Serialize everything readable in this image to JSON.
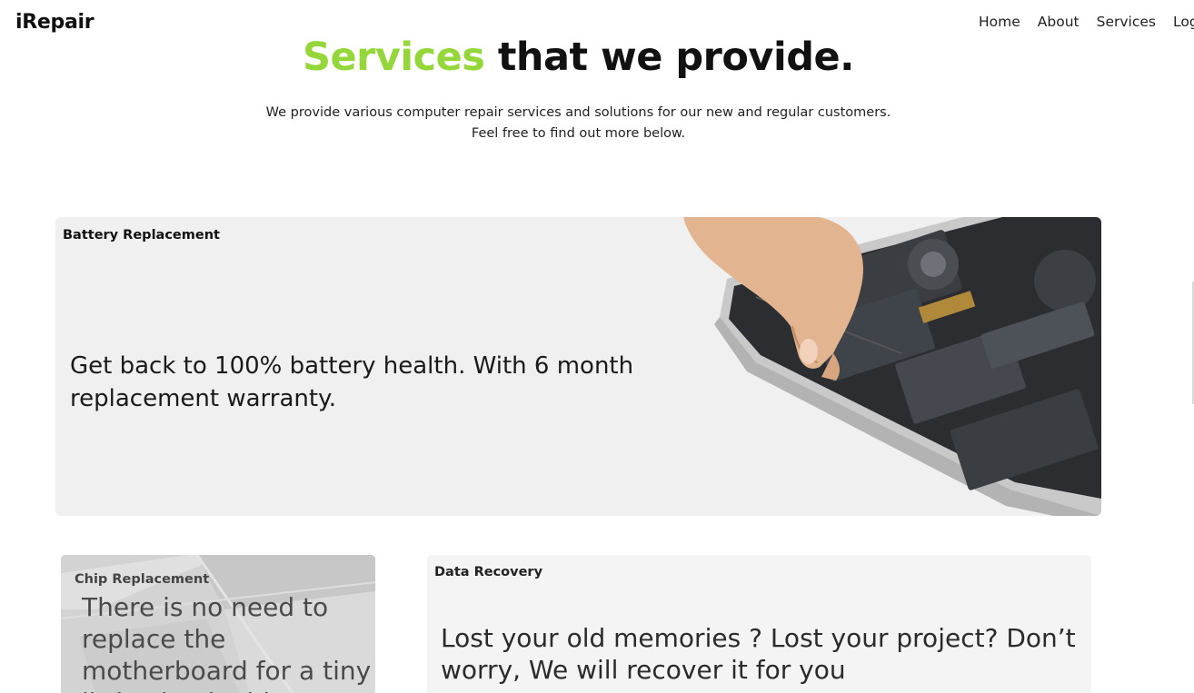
{
  "brand": "iRepair",
  "nav": [
    "Home",
    "About",
    "Services",
    "Log"
  ],
  "hero": {
    "title_accent": "Services",
    "title_rest": " that we provide.",
    "subtitle_line1": "We provide various computer repair services and solutions for our new and regular customers.",
    "subtitle_line2": "Feel free to find out more below."
  },
  "services": {
    "battery": {
      "label": "Battery Replacement",
      "description": "Get back to 100% battery health. With 6 month replacement warranty."
    },
    "chip": {
      "label": "Chip Replacement",
      "description": "There is no need to replace the motherboard for a tiny little circuit chip."
    },
    "data": {
      "label": "Data Recovery",
      "description": "Lost your old memories ? Lost your project? Don’t worry, We will recover it for you"
    }
  },
  "colors": {
    "accent": "#95d63a",
    "card_bg": "#f0f0f0"
  }
}
